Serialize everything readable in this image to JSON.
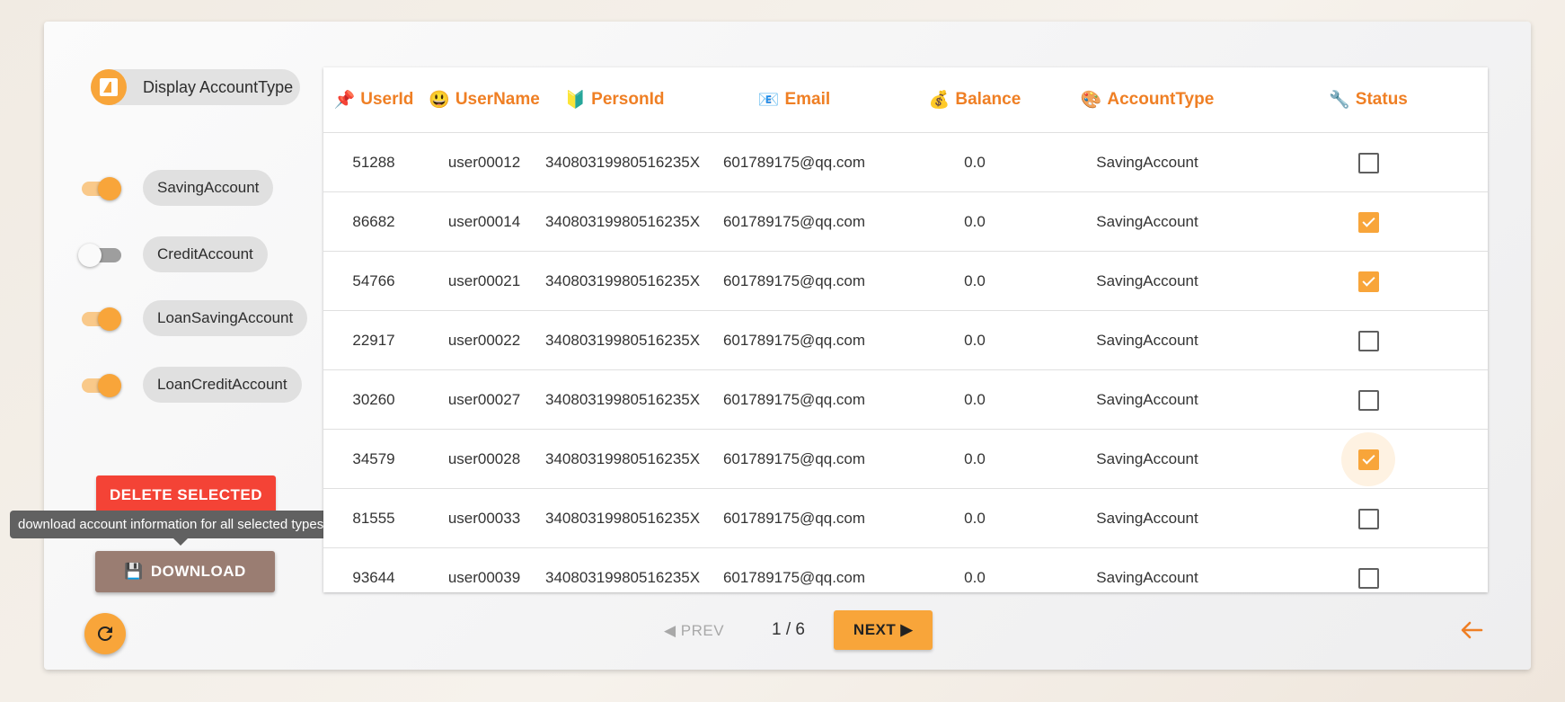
{
  "sidebar": {
    "display_chip": {
      "label": "Display AccountType",
      "icon": "account-type-icon"
    },
    "toggles": [
      {
        "label": "SavingAccount",
        "on": true
      },
      {
        "label": "CreditAccount",
        "on": false
      },
      {
        "label": "LoanSavingAccount",
        "on": true
      },
      {
        "label": "LoanCreditAccount",
        "on": true
      }
    ],
    "delete_label": "DELETE SELECTED",
    "download_label": "DOWNLOAD",
    "download_icon": "💾",
    "tooltip": "download account information for all selected types",
    "refresh_icon": "refresh-icon"
  },
  "table": {
    "headers": [
      {
        "label": "UserId",
        "icon": "📌"
      },
      {
        "label": "UserName",
        "icon": "😃"
      },
      {
        "label": "PersonId",
        "icon": "🔰"
      },
      {
        "label": "Email",
        "icon": "📧"
      },
      {
        "label": "Balance",
        "icon": "💰"
      },
      {
        "label": "AccountType",
        "icon": "🎨"
      },
      {
        "label": "Status",
        "icon": "🔧"
      }
    ],
    "rows": [
      {
        "userid": "51288",
        "username": "user00012",
        "personid": "34080319980516235X",
        "email": "601789175@qq.com",
        "balance": "0.0",
        "type": "SavingAccount",
        "checked": false
      },
      {
        "userid": "86682",
        "username": "user00014",
        "personid": "34080319980516235X",
        "email": "601789175@qq.com",
        "balance": "0.0",
        "type": "SavingAccount",
        "checked": true
      },
      {
        "userid": "54766",
        "username": "user00021",
        "personid": "34080319980516235X",
        "email": "601789175@qq.com",
        "balance": "0.0",
        "type": "SavingAccount",
        "checked": true
      },
      {
        "userid": "22917",
        "username": "user00022",
        "personid": "34080319980516235X",
        "email": "601789175@qq.com",
        "balance": "0.0",
        "type": "SavingAccount",
        "checked": false
      },
      {
        "userid": "30260",
        "username": "user00027",
        "personid": "34080319980516235X",
        "email": "601789175@qq.com",
        "balance": "0.0",
        "type": "SavingAccount",
        "checked": false
      },
      {
        "userid": "34579",
        "username": "user00028",
        "personid": "34080319980516235X",
        "email": "601789175@qq.com",
        "balance": "0.0",
        "type": "SavingAccount",
        "checked": true,
        "focused": true
      },
      {
        "userid": "81555",
        "username": "user00033",
        "personid": "34080319980516235X",
        "email": "601789175@qq.com",
        "balance": "0.0",
        "type": "SavingAccount",
        "checked": false
      },
      {
        "userid": "93644",
        "username": "user00039",
        "personid": "34080319980516235X",
        "email": "601789175@qq.com",
        "balance": "0.0",
        "type": "SavingAccount",
        "checked": false
      }
    ]
  },
  "pagination": {
    "prev_label": "◀ PREV",
    "page": "1 / 6",
    "next_label": "NEXT ▶",
    "back_icon": "arrow-left-icon"
  },
  "colors": {
    "accent": "#f8a53a",
    "header_text": "#ef7f24",
    "delete": "#f44336",
    "download": "#9a7d72"
  }
}
